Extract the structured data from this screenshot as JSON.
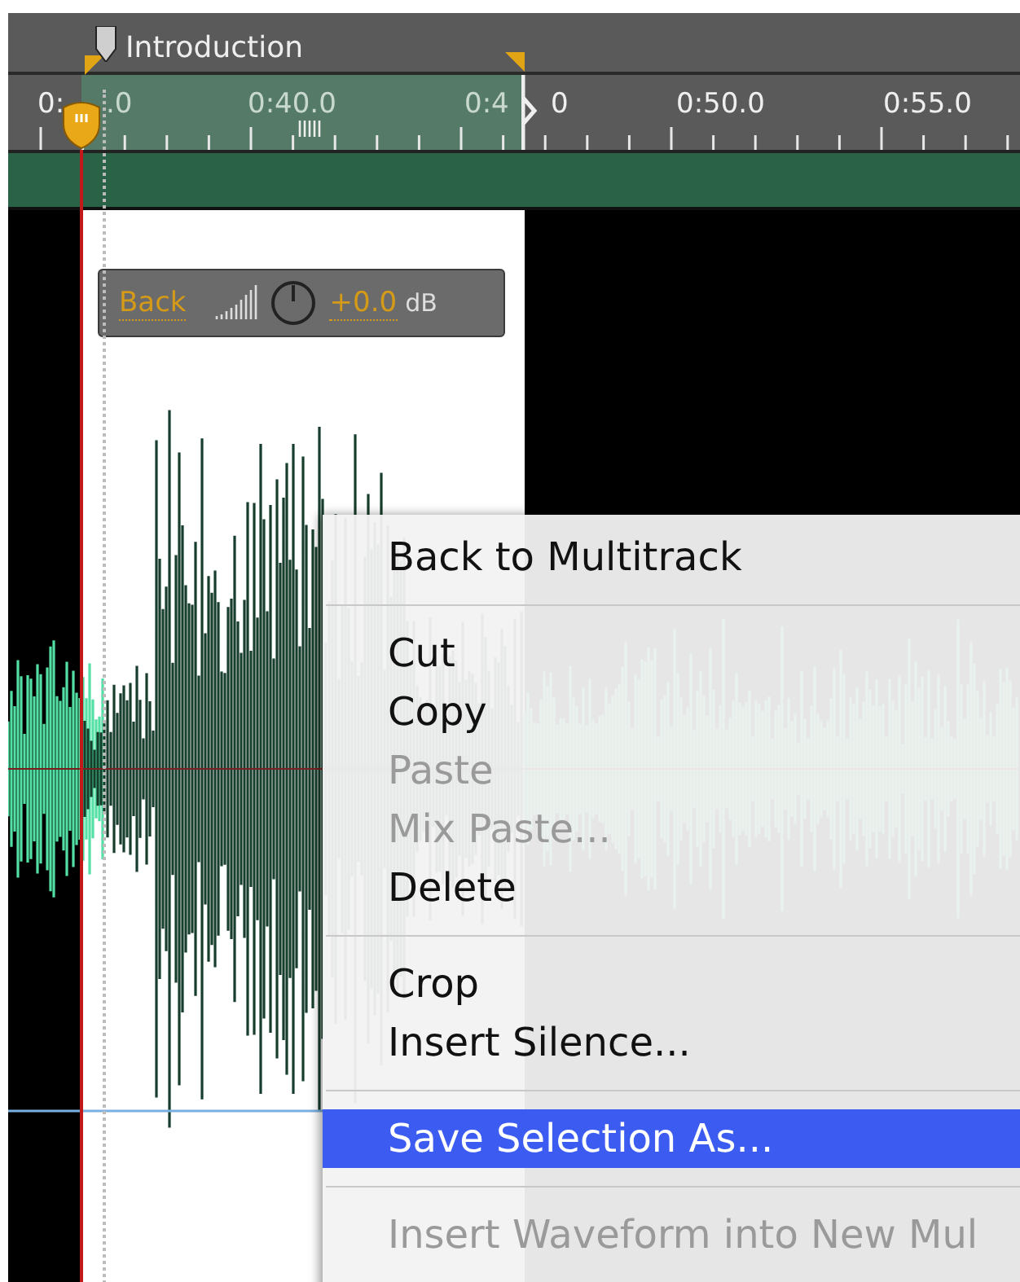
{
  "marker": {
    "label": "Introduction"
  },
  "ruler": {
    "labels": [
      "0:",
      ".0",
      "0:40.0",
      "0:4",
      "0",
      "0:50.0",
      "0:55.0"
    ]
  },
  "clip_gain": {
    "back": "Back",
    "value": "+0.0",
    "unit": "dB"
  },
  "context_menu": {
    "items": [
      {
        "kind": "item",
        "label": "Back to Multitrack",
        "disabled": false,
        "selected": false
      },
      {
        "kind": "separator"
      },
      {
        "kind": "item",
        "label": "Cut",
        "disabled": false,
        "selected": false
      },
      {
        "kind": "item",
        "label": "Copy",
        "disabled": false,
        "selected": false
      },
      {
        "kind": "item",
        "label": "Paste",
        "disabled": true,
        "selected": false
      },
      {
        "kind": "item",
        "label": "Mix Paste...",
        "disabled": true,
        "selected": false
      },
      {
        "kind": "item",
        "label": "Delete",
        "disabled": false,
        "selected": false
      },
      {
        "kind": "separator"
      },
      {
        "kind": "item",
        "label": "Crop",
        "disabled": false,
        "selected": false
      },
      {
        "kind": "item",
        "label": "Insert Silence...",
        "disabled": false,
        "selected": false
      },
      {
        "kind": "separator"
      },
      {
        "kind": "item",
        "label": "Save Selection As...",
        "disabled": false,
        "selected": true
      },
      {
        "kind": "separator"
      },
      {
        "kind": "item",
        "label": "Insert Waveform into New Mul",
        "disabled": true,
        "selected": false
      }
    ]
  }
}
